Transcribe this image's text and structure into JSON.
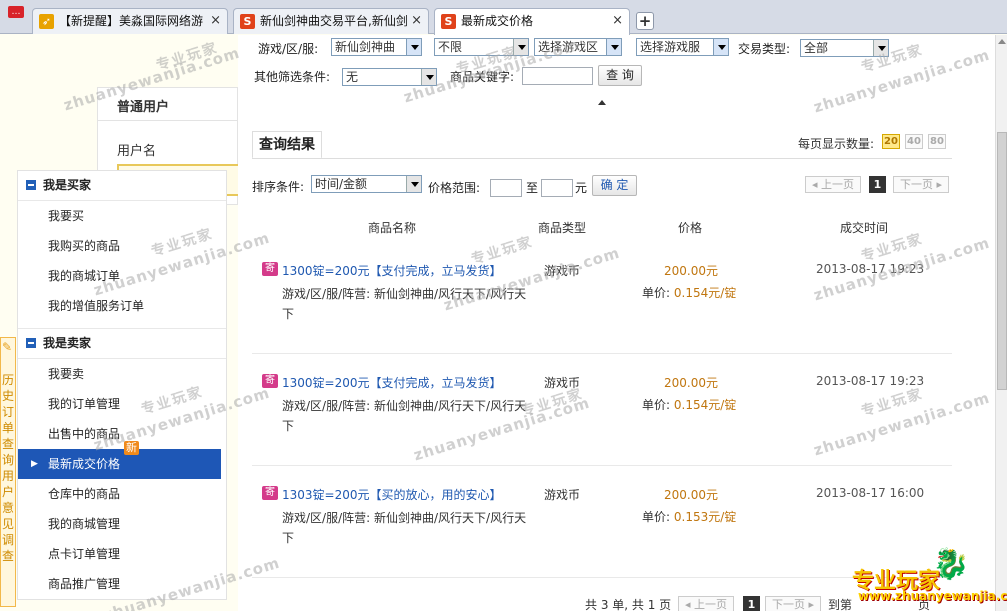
{
  "tabs": [
    {
      "icon": "bookmark-icon",
      "label": "【新提醒】美淼国际网络游",
      "active": false
    },
    {
      "icon": "s-logo-icon",
      "label": "新仙剑神曲交易平台,新仙剑",
      "active": false
    },
    {
      "icon": "s-logo-icon",
      "label": "最新成交价格",
      "active": true
    }
  ],
  "colors": {
    "accent": "#1e57b6",
    "price": "#c0760f",
    "badge": "#f08a1c"
  },
  "login": {
    "title": "普通用户",
    "username_label": "用户名"
  },
  "menu": {
    "buyer_title": "我是买家",
    "buyer_items": [
      "我要买",
      "我购买的商品",
      "我的商城订单",
      "我的增值服务订单"
    ],
    "seller_title": "我是卖家",
    "seller_items": [
      "我要卖",
      "我的订单管理",
      "出售中的商品",
      "最新成交价格",
      "仓库中的商品",
      "我的商城管理",
      "点卡订单管理",
      "商品推广管理"
    ],
    "new_badge": "新"
  },
  "side_bar": {
    "text": "历史订单查询用户意见调查"
  },
  "filters": {
    "game_label": "游戏/区/服:",
    "game_value": "新仙剑神曲",
    "zone_value": "不限",
    "area_placeholder": "选择游戏区",
    "server_placeholder": "选择游戏服",
    "trade_type_label": "交易类型:",
    "trade_type_value": "全部",
    "other_label": "其他筛选条件:",
    "other_value": "无",
    "keyword_label": "商品关键字:",
    "search_button": "查 询"
  },
  "results": {
    "tab_label": "查询结果",
    "per_page_label": "每页显示数量:",
    "per_page_options": [
      "20",
      "40",
      "80"
    ],
    "sort_label": "排序条件:",
    "sort_value": "时间/金额",
    "price_range_label": "价格范围:",
    "to_label": "至",
    "yuan_label": "元",
    "confirm_button": "确 定",
    "prev_page": "上一页",
    "next_page": "下一页",
    "current_page": "1"
  },
  "table": {
    "headers": [
      "商品名称",
      "商品类型",
      "价格",
      "成交时间"
    ],
    "rows": [
      {
        "badge": "寄",
        "name": "1300锭=200元【支付完成，立马发货】",
        "server": "游戏/区/服/阵营: 新仙剑神曲/风行天下/风行天下",
        "type": "游戏币",
        "price": "200.00元",
        "unit_label": "单价:",
        "unit_price": "0.154元/锭",
        "time": "2013-08-17 19:23"
      },
      {
        "badge": "寄",
        "name": "1300锭=200元【支付完成，立马发货】",
        "server": "游戏/区/服/阵营: 新仙剑神曲/风行天下/风行天下",
        "type": "游戏币",
        "price": "200.00元",
        "unit_label": "单价:",
        "unit_price": "0.154元/锭",
        "time": "2013-08-17 19:23"
      },
      {
        "badge": "寄",
        "name": "1303锭=200元【买的放心，用的安心】",
        "server": "游戏/区/服/阵营: 新仙剑神曲/风行天下/风行天下",
        "type": "游戏币",
        "price": "200.00元",
        "unit_label": "单价:",
        "unit_price": "0.153元/锭",
        "time": "2013-08-17 16:00"
      }
    ]
  },
  "footer": {
    "summary": "共 3 单, 共 1 页",
    "prev": "上一页",
    "page": "1",
    "next": "下一页",
    "goto": "到第",
    "page_suffix": "页"
  },
  "watermark": {
    "pinyin": "zhuanyewanjia.com",
    "chinese": "专业玩家",
    "logo_text": "专业玩家",
    "logo_url": "www.zhuanyewanjia.com"
  }
}
